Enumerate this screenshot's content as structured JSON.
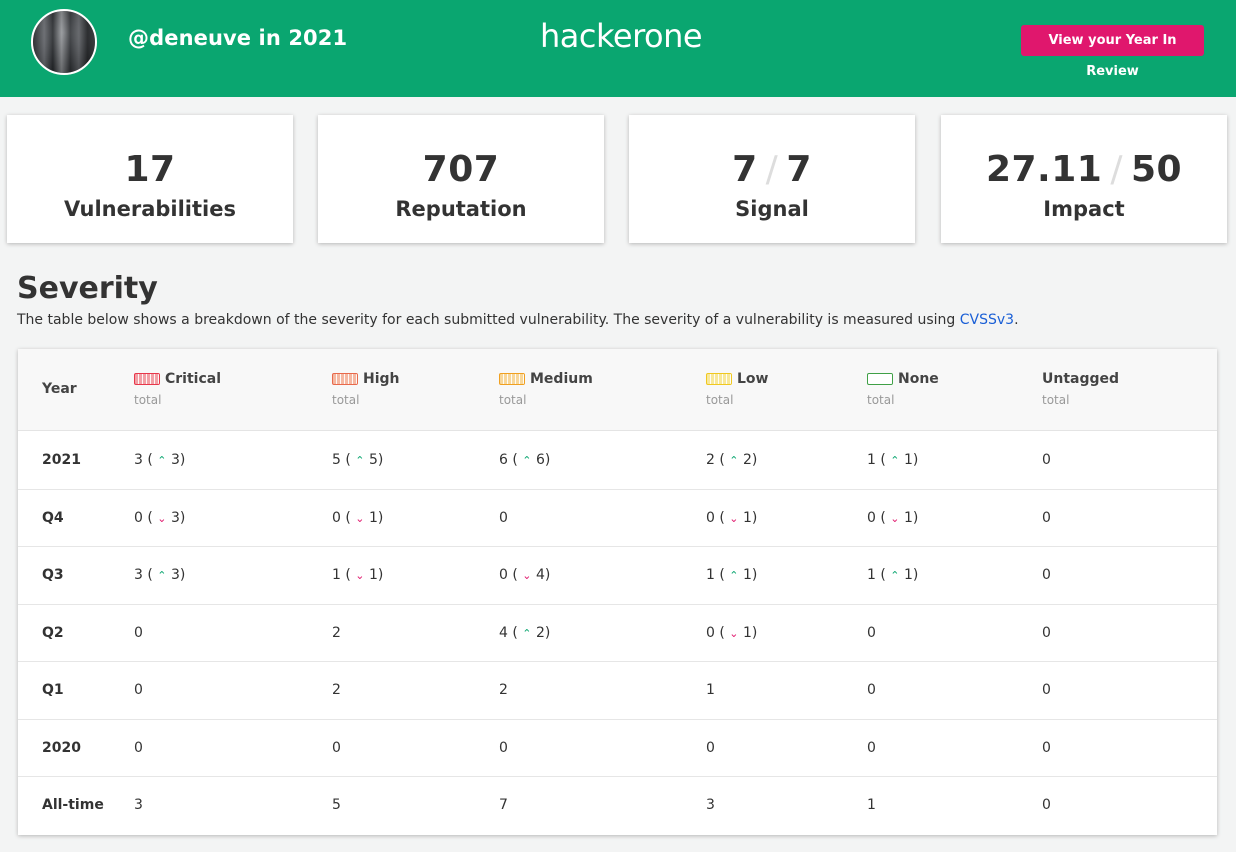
{
  "header": {
    "user_title": "@deneuve in 2021",
    "logo": "hackerone",
    "review_button": "View your Year In Review",
    "colors": {
      "bar": "#0aa670",
      "button": "#e0176d"
    }
  },
  "stats": [
    {
      "value": "17",
      "label": "Vulnerabilities"
    },
    {
      "value": "707",
      "label": "Reputation"
    },
    {
      "value": "7",
      "max": "7",
      "label": "Signal"
    },
    {
      "value": "27.11",
      "max": "50",
      "label": "Impact"
    }
  ],
  "severity": {
    "title": "Severity",
    "description": "The table below shows a breakdown of the severity for each submitted vulnerability. The severity of a vulnerability is measured using ",
    "link": "CVSSv3",
    "description_end": ".",
    "year_header": "Year",
    "columns": [
      {
        "name": "Critical",
        "sub": "total",
        "color": "#e8374b",
        "fill": "#f2a0a6"
      },
      {
        "name": "High",
        "sub": "total",
        "color": "#e8694b",
        "fill": "#f5b8a2"
      },
      {
        "name": "Medium",
        "sub": "total",
        "color": "#f0a020",
        "fill": "#f8d79a"
      },
      {
        "name": "Low",
        "sub": "total",
        "color": "#f0c820",
        "fill": "#f8e89a"
      },
      {
        "name": "None",
        "sub": "total",
        "color": "#3fa046",
        "fill": "#ffffff"
      },
      {
        "name": "Untagged",
        "sub": "total",
        "color": "",
        "fill": ""
      }
    ],
    "rows": [
      {
        "label": "2021",
        "cells": [
          {
            "v": "3",
            "d": "up",
            "dv": "3"
          },
          {
            "v": "5",
            "d": "up",
            "dv": "5"
          },
          {
            "v": "6",
            "d": "up",
            "dv": "6"
          },
          {
            "v": "2",
            "d": "up",
            "dv": "2"
          },
          {
            "v": "1",
            "d": "up",
            "dv": "1"
          },
          {
            "v": "0"
          }
        ]
      },
      {
        "label": "Q4",
        "cells": [
          {
            "v": "0",
            "d": "down",
            "dv": "3"
          },
          {
            "v": "0",
            "d": "down",
            "dv": "1"
          },
          {
            "v": "0"
          },
          {
            "v": "0",
            "d": "down",
            "dv": "1"
          },
          {
            "v": "0",
            "d": "down",
            "dv": "1"
          },
          {
            "v": "0"
          }
        ]
      },
      {
        "label": "Q3",
        "cells": [
          {
            "v": "3",
            "d": "up",
            "dv": "3"
          },
          {
            "v": "1",
            "d": "down",
            "dv": "1"
          },
          {
            "v": "0",
            "d": "down",
            "dv": "4"
          },
          {
            "v": "1",
            "d": "up",
            "dv": "1"
          },
          {
            "v": "1",
            "d": "up",
            "dv": "1"
          },
          {
            "v": "0"
          }
        ]
      },
      {
        "label": "Q2",
        "cells": [
          {
            "v": "0"
          },
          {
            "v": "2"
          },
          {
            "v": "4",
            "d": "up",
            "dv": "2"
          },
          {
            "v": "0",
            "d": "down",
            "dv": "1"
          },
          {
            "v": "0"
          },
          {
            "v": "0"
          }
        ]
      },
      {
        "label": "Q1",
        "cells": [
          {
            "v": "0"
          },
          {
            "v": "2"
          },
          {
            "v": "2"
          },
          {
            "v": "1"
          },
          {
            "v": "0"
          },
          {
            "v": "0"
          }
        ]
      },
      {
        "label": "2020",
        "cells": [
          {
            "v": "0"
          },
          {
            "v": "0"
          },
          {
            "v": "0"
          },
          {
            "v": "0"
          },
          {
            "v": "0"
          },
          {
            "v": "0"
          }
        ]
      },
      {
        "label": "All-time",
        "cells": [
          {
            "v": "3"
          },
          {
            "v": "5"
          },
          {
            "v": "7"
          },
          {
            "v": "3"
          },
          {
            "v": "1"
          },
          {
            "v": "0"
          }
        ]
      }
    ]
  }
}
